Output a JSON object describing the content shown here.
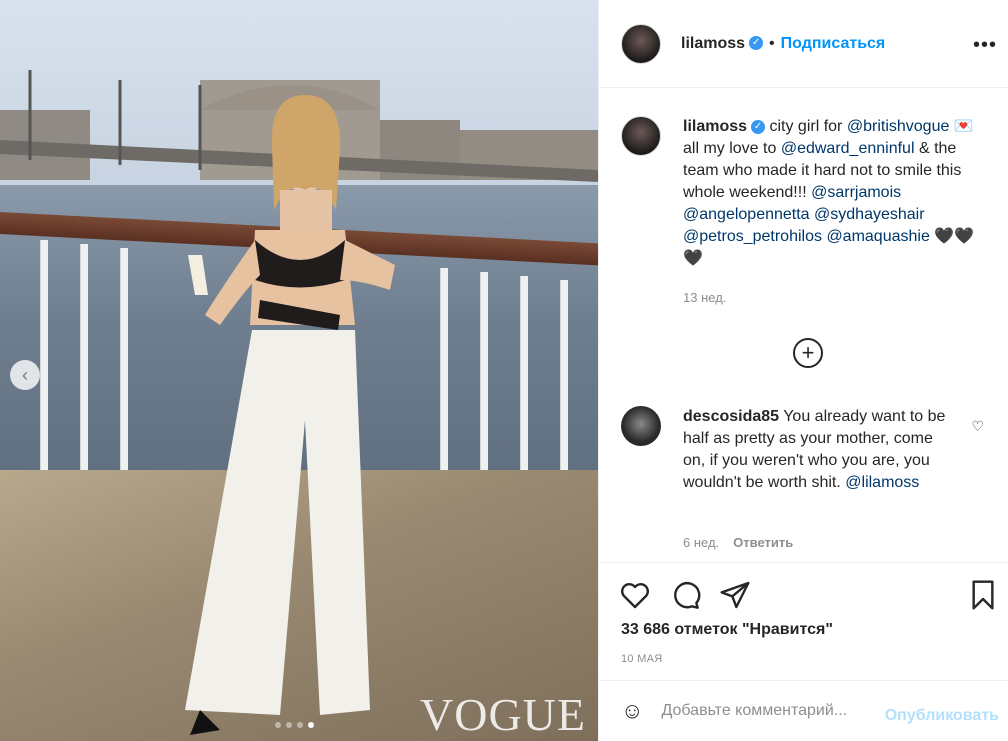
{
  "post": {
    "username": "lilamoss",
    "follow_label": "Подписаться",
    "separator": "•",
    "more_label": "•••",
    "verified_mark": "✓"
  },
  "caption": {
    "username": "lilamoss",
    "text_1": "city girl for",
    "mention_1": "@britishvogue",
    "envelope_icon": "💌",
    "text_2": "all my love to",
    "mention_2": "@edward_enninful",
    "text_3": "& the team who made it hard not to smile this whole weekend!!!",
    "mention_3": "@sarrjamois",
    "mention_4": "@angelopennetta",
    "mention_5": "@sydhayeshair",
    "mention_6": "@petros_petrohilos",
    "mention_7": "@amaquashie",
    "hearts": "🖤🖤🖤",
    "time": "13 нед."
  },
  "load_more_label": "+",
  "comment": {
    "username": "descosida85",
    "text": "You already want to be half as pretty as your mother, come on, if you weren't who you are, you wouldn't be worth shit.",
    "mention": "@lilamoss",
    "time": "6 нед.",
    "reply_label": "Ответить",
    "heart": "♡"
  },
  "actions": {
    "likes": "33 686 отметок \"Нравится\"",
    "date": "10 МАЯ"
  },
  "add_comment": {
    "placeholder": "Добавьте комментарий...",
    "publish_label": "Опубликовать",
    "emoji": "☺"
  },
  "photo": {
    "watermark": "VOGUE",
    "prev_arrow": "‹",
    "slide_count": 4,
    "active_slide": 4
  },
  "colors": {
    "accent": "#0095f6",
    "mention": "#00376b",
    "muted": "#8e8e8e",
    "publish_disabled": "#b2dffc"
  }
}
